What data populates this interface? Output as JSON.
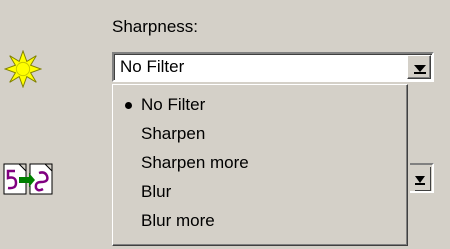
{
  "sharpness": {
    "label": "Sharpness:",
    "selected": "No Filter",
    "options": [
      "No Filter",
      "Sharpen",
      "Sharpen more",
      "Blur",
      "Blur more"
    ]
  },
  "icons": {
    "sharpness": "sun-icon",
    "conversion": "convert-icon"
  },
  "colors": {
    "background": "#d4d0c8",
    "sun": "#ffff00",
    "convert_number": "#800080",
    "convert_arrow": "#008000"
  }
}
